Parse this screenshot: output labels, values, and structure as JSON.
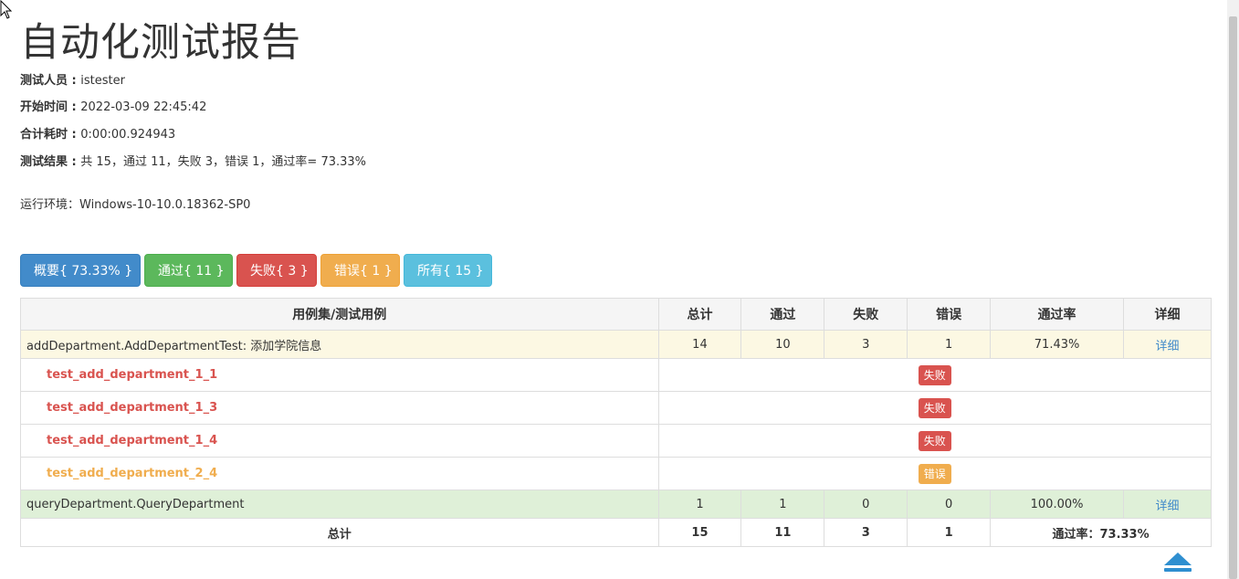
{
  "title": "自动化测试报告",
  "info": {
    "tester_label": "测试人员 : ",
    "tester": "istester",
    "start_label": "开始时间 : ",
    "start": "2022-03-09 22:45:42",
    "duration_label": "合计耗时 : ",
    "duration": "0:00:00.924943",
    "result_label": "测试结果 : ",
    "result": "共 15，通过 11，失败 3，错误 1，通过率= 73.33%",
    "env": "运行环境：Windows-10-10.0.18362-SP0"
  },
  "filters": {
    "summary": "概要{ 73.33% }",
    "pass": "通过{ 11 }",
    "fail": "失败{ 3 }",
    "error": "错误{ 1 }",
    "all": "所有{ 15 }"
  },
  "table": {
    "headers": [
      "用例集/测试用例",
      "总计",
      "通过",
      "失败",
      "错误",
      "通过率",
      "详细"
    ],
    "suite1": {
      "name": "addDepartment.AddDepartmentTest: 添加学院信息",
      "total": "14",
      "pass": "10",
      "fail": "3",
      "error": "1",
      "rate": "71.43%",
      "detail": "详细"
    },
    "cases": [
      {
        "name": "test_add_department_1_1",
        "status": "失败"
      },
      {
        "name": "test_add_department_1_3",
        "status": "失败"
      },
      {
        "name": "test_add_department_1_4",
        "status": "失败"
      },
      {
        "name": "test_add_department_2_4",
        "status": "错误"
      }
    ],
    "suite2": {
      "name": "queryDepartment.QueryDepartment",
      "total": "1",
      "pass": "1",
      "fail": "0",
      "error": "0",
      "rate": "100.00%",
      "detail": "详细"
    },
    "total": {
      "label": "总计",
      "total": "15",
      "pass": "11",
      "fail": "3",
      "error": "1",
      "rate": "通过率：73.33%"
    }
  },
  "colors": {
    "primary": "#428bca",
    "success": "#5cb85c",
    "danger": "#d9534f",
    "warning": "#f0ad4e",
    "info": "#5bc0de"
  }
}
